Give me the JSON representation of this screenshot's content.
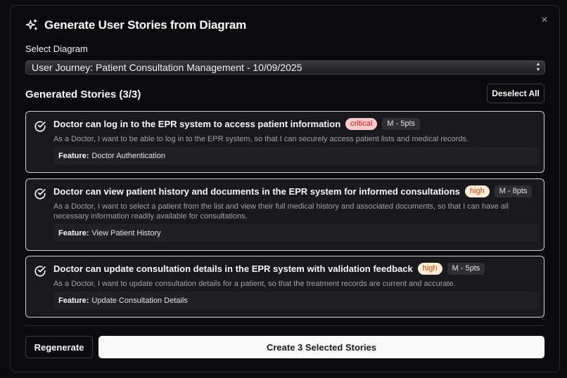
{
  "dialog": {
    "title": "Generate User Stories from Diagram",
    "close_label": "×",
    "sparkle_icon": "sparkles-icon"
  },
  "select": {
    "label": "Select Diagram",
    "value": "User Journey: Patient Consultation Management - 10/09/2025"
  },
  "stories_section": {
    "title": "Generated Stories (3/3)",
    "deselect_label": "Deselect All"
  },
  "stories": [
    {
      "title": "Doctor can log in to the EPR system to access patient information",
      "priority": "critical",
      "points": "M - 5pts",
      "description": "As a Doctor, I want to be able to log in to the EPR system, so that I can securely access patient lists and medical records.",
      "feature_label": "Feature:",
      "feature_value": "Doctor Authentication",
      "selected": true
    },
    {
      "title": "Doctor can view patient history and documents in the EPR system for informed consultations",
      "priority": "high",
      "points": "M - 8pts",
      "description": "As a Doctor, I want to select a patient from the list and view their full medical history and associated documents, so that I can have all necessary information readily available for consultations.",
      "feature_label": "Feature:",
      "feature_value": "View Patient History",
      "selected": true
    },
    {
      "title": "Doctor can update consultation details in the EPR system with validation feedback",
      "priority": "high",
      "points": "M - 5pts",
      "description": "As a Doctor, I want to update consultation details for a patient, so that the treatment records are current and accurate.",
      "feature_label": "Feature:",
      "feature_value": "Update Consultation Details",
      "selected": true
    }
  ],
  "footer": {
    "regenerate_label": "Regenerate",
    "create_label": "Create 3 Selected Stories"
  },
  "colors": {
    "critical_bg": "#fecaca",
    "critical_text": "#b91c1c",
    "high_bg": "#ffedd5",
    "high_text": "#c2410c",
    "primary_button": "#fafafa"
  }
}
